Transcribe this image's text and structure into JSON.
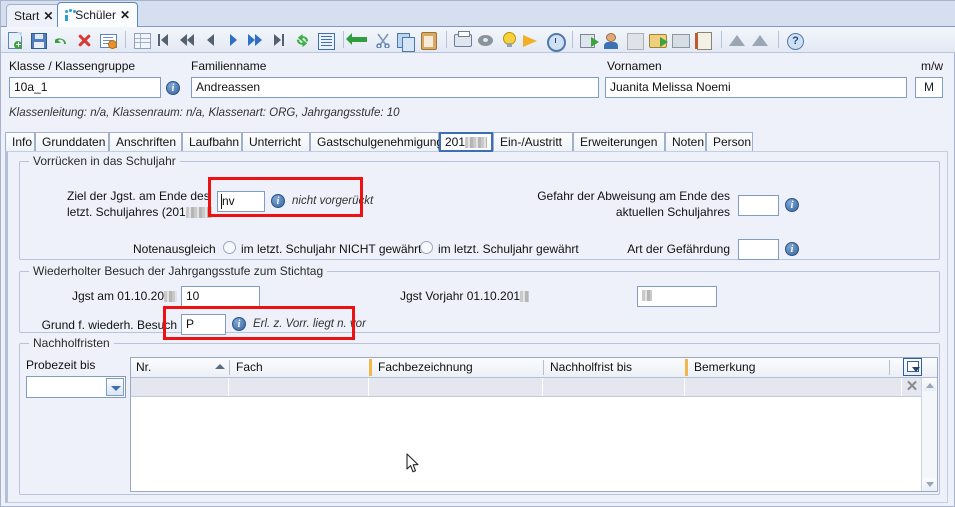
{
  "window": {
    "tabs": [
      {
        "label": "Start",
        "icon": "none",
        "active": false,
        "close": "✕"
      },
      {
        "label": "Schüler",
        "icon": "students-icon",
        "active": true,
        "close": "✕"
      }
    ]
  },
  "toolbar": {
    "items": [
      {
        "name": "new-document-button",
        "title": "Neu"
      },
      {
        "name": "save-button",
        "title": "Speichern"
      },
      {
        "name": "undo-button",
        "title": "Rückgängig"
      },
      {
        "name": "delete-button",
        "title": "Löschen"
      },
      {
        "name": "edit-record-button",
        "title": "Datensatz bearbeiten"
      },
      {
        "name": "table-view-button",
        "title": "Tabellenansicht"
      },
      {
        "name": "first-record-button",
        "title": "Erster"
      },
      {
        "name": "fast-rewind-button",
        "title": "Schnell zurück"
      },
      {
        "name": "previous-record-button",
        "title": "Vorheriger"
      },
      {
        "name": "next-record-button",
        "title": "Nächster"
      },
      {
        "name": "fast-forward-button",
        "title": "Schnell vor"
      },
      {
        "name": "last-record-button",
        "title": "Letzter"
      },
      {
        "name": "refresh-button",
        "title": "Aktualisieren"
      },
      {
        "name": "list-view-button",
        "title": "Liste"
      },
      {
        "name": "back-button",
        "title": "Zurück"
      },
      {
        "name": "cut-button",
        "title": "Ausschneiden"
      },
      {
        "name": "copy-button",
        "title": "Kopieren"
      },
      {
        "name": "paste-button",
        "title": "Einfügen"
      },
      {
        "name": "print-button",
        "title": "Drucken"
      },
      {
        "name": "cd-button",
        "title": "Datenträger"
      },
      {
        "name": "lightbulb-button",
        "title": "Hinweise"
      },
      {
        "name": "megaphone-button",
        "title": "Mitteilungen"
      },
      {
        "name": "clock-button",
        "title": "Termine"
      },
      {
        "name": "package-export-button",
        "title": "Export"
      },
      {
        "name": "person-button",
        "title": "Person"
      },
      {
        "name": "import-tb-button",
        "title": "Import"
      },
      {
        "name": "folder-export-button",
        "title": "Ordner"
      },
      {
        "name": "envelope-button",
        "title": "Nachricht"
      },
      {
        "name": "address-book-button",
        "title": "Adressbuch"
      },
      {
        "name": "mountain-button",
        "title": "Ansicht 1"
      },
      {
        "name": "mountain2-button",
        "title": "Ansicht 2"
      },
      {
        "name": "help-button",
        "title": "Hilfe"
      }
    ]
  },
  "header": {
    "klasse_label": "Klasse / Klassengruppe",
    "klasse_value": "10a_1",
    "familienname_label": "Familienname",
    "familienname_value": "Andreassen",
    "vornamen_label": "Vornamen",
    "vornamen_value": "Juanita Melissa Noemi",
    "mw_label": "m/w",
    "mw_value": "M",
    "info_glyph": "i",
    "subinfo": "Klassenleitung: n/a, Klassenraum: n/a, Klassenart: ORG, Jahrgangsstufe: 10"
  },
  "page_tabs": [
    {
      "label": "Info",
      "active": false
    },
    {
      "label": "Grunddaten",
      "active": false
    },
    {
      "label": "Anschriften",
      "active": false
    },
    {
      "label": "Laufbahn",
      "active": false
    },
    {
      "label": "Unterricht",
      "active": false
    },
    {
      "label": "Gastschulgenehmigung",
      "active": false
    },
    {
      "label": "201",
      "redacted": true,
      "active": true
    },
    {
      "label": "Ein-/Austritt",
      "active": false
    },
    {
      "label": "Erweiterungen",
      "active": false
    },
    {
      "label": "Noten",
      "active": false
    },
    {
      "label": "Person",
      "active": false
    }
  ],
  "groups": {
    "vorruecken": {
      "title": "Vorrücken in das Schuljahr",
      "ziel_label_line1": "Ziel der Jgst. am Ende des",
      "ziel_label_line2_pre": "letzt. Schuljahres (201",
      "ziel_label_line2_post": "",
      "ziel_value": "nv",
      "ziel_hint": "nicht vorgerückt",
      "gefahr_label_line1": "Gefahr der Abweisung am Ende des",
      "gefahr_label_line2": "aktuellen Schuljahres",
      "gefahr_value": "",
      "notenausgleich_label": "Notenausgleich",
      "radio1_label": "im letzt. Schuljahr NICHT gewährt",
      "radio1_checked": false,
      "radio2_label": "im letzt. Schuljahr gewährt",
      "radio2_checked": false,
      "art_label": "Art der Gefährdung",
      "art_value": ""
    },
    "wiederholt": {
      "title": "Wiederholter Besuch der Jahrgangsstufe zum Stichtag",
      "jgst_label_pre": "Jgst am 01.10.20",
      "jgst_value": "10",
      "jgst_vorjahr_label_pre": "Jgst Vorjahr 01.10.201",
      "jgst_vorjahr_value": "",
      "grund_label": "Grund f. wiederh. Besuch",
      "grund_value": "P",
      "grund_hint": "Erl. z. Vorr. liegt n. vor"
    },
    "nachholfristen": {
      "title": "Nachholfristen",
      "probezeit_label": "Probezeit bis",
      "probezeit_value": "",
      "columns": [
        {
          "label": "Nr.",
          "sorted": "asc"
        },
        {
          "label": "Fach",
          "sorted": ""
        },
        {
          "label": "Fachbezeichnung",
          "sorted": ""
        },
        {
          "label": "Nachholfrist bis",
          "sorted": ""
        },
        {
          "label": "Bemerkung",
          "sorted": ""
        }
      ],
      "rows": [],
      "clear_filter_label": "✕",
      "sort_asc_glyph": "▲"
    }
  },
  "colors": {
    "accent": "#3d6fb5",
    "highlight_box": "#ee1111",
    "panel_bg": "#eef1f9",
    "field_border": "#7f9dc0",
    "header_orange": "#f3b64a"
  }
}
